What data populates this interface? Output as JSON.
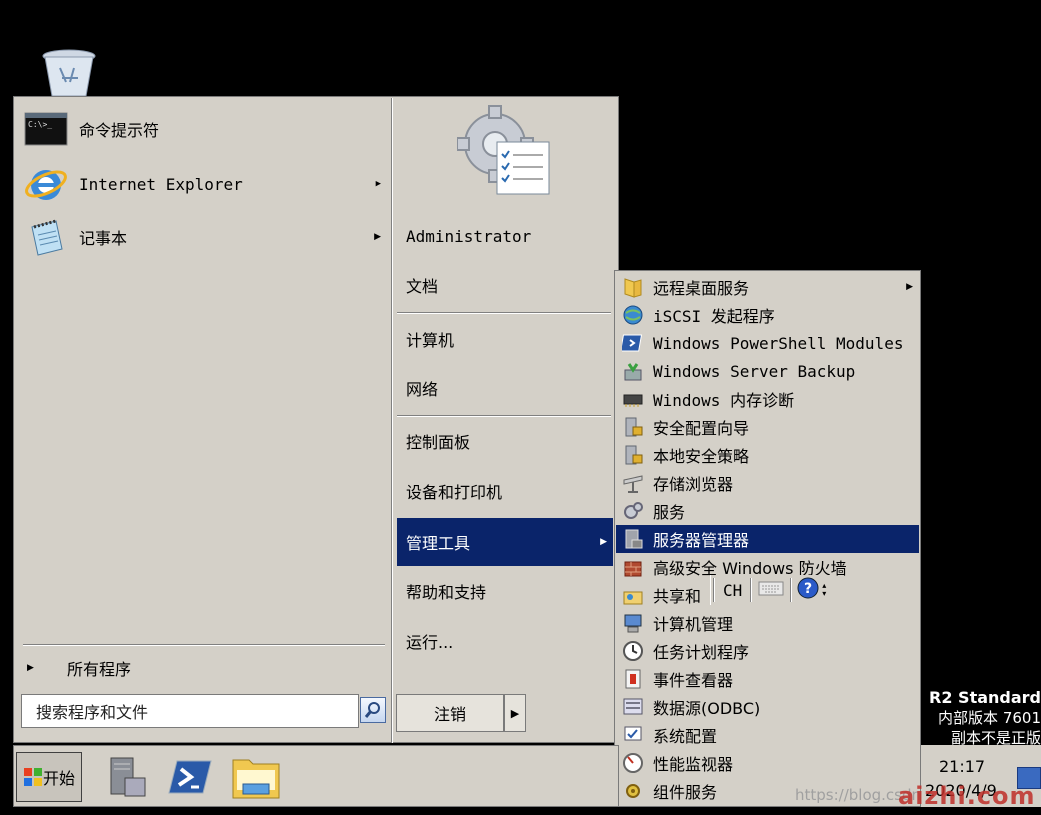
{
  "desktop": {
    "recycle_bin_icon": "recycle-bin-icon"
  },
  "start_menu": {
    "pinned_programs": [
      {
        "label": "命令提示符",
        "icon": "cmd-icon",
        "has_submenu": false
      },
      {
        "label": "Internet Explorer",
        "icon": "ie-icon",
        "has_submenu": true
      },
      {
        "label": "记事本",
        "icon": "notepad-icon",
        "has_submenu": true
      }
    ],
    "all_programs_label": "所有程序",
    "search_placeholder": "搜索程序和文件",
    "right_items": [
      {
        "label": "Administrator"
      },
      {
        "label": "文档"
      },
      {
        "label": "计算机"
      },
      {
        "label": "网络"
      },
      {
        "label": "控制面板"
      },
      {
        "label": "设备和打印机"
      },
      {
        "label": "管理工具",
        "selected": true,
        "has_submenu": true
      },
      {
        "label": "帮助和支持"
      },
      {
        "label": "运行..."
      }
    ],
    "logoff_label": "注销"
  },
  "admin_tools_submenu": {
    "items": [
      {
        "label": "远程桌面服务",
        "icon": "folder-icon",
        "has_submenu": true
      },
      {
        "label": "iSCSI 发起程序",
        "icon": "iscsi-icon"
      },
      {
        "label": "Windows PowerShell Modules",
        "icon": "powershell-icon"
      },
      {
        "label": "Windows Server Backup",
        "icon": "backup-icon"
      },
      {
        "label": "Windows 内存诊断",
        "icon": "memory-icon"
      },
      {
        "label": "安全配置向导",
        "icon": "security-wizard-icon"
      },
      {
        "label": "本地安全策略",
        "icon": "local-policy-icon"
      },
      {
        "label": "存储浏览器",
        "icon": "storage-icon"
      },
      {
        "label": "服务",
        "icon": "services-icon"
      },
      {
        "label": "服务器管理器",
        "icon": "server-manager-icon",
        "selected": true
      },
      {
        "label": "高级安全 Windows 防火墙",
        "icon": "firewall-icon"
      },
      {
        "label": "共享和",
        "icon": "share-icon"
      },
      {
        "label": "计算机管理",
        "icon": "computer-mgmt-icon"
      },
      {
        "label": "任务计划程序",
        "icon": "task-scheduler-icon"
      },
      {
        "label": "事件查看器",
        "icon": "event-viewer-icon"
      },
      {
        "label": "数据源(ODBC)",
        "icon": "odbc-icon"
      },
      {
        "label": "系统配置",
        "icon": "sysconfig-icon"
      },
      {
        "label": "性能监视器",
        "icon": "perfmon-icon"
      },
      {
        "label": "组件服务",
        "icon": "component-services-icon"
      }
    ]
  },
  "language_bar": {
    "lang": "CH"
  },
  "taskbar": {
    "start_label": "开始",
    "pinned": [
      "server-manager-icon",
      "powershell-icon",
      "explorer-icon"
    ],
    "time": "21:17",
    "date": "2020/4/9"
  },
  "watermark": {
    "line1": "R2 Standard",
    "line2": "内部版本 7601",
    "line3": "副本不是正版",
    "blog": "https://blog.csdn",
    "site": "aizhi.com"
  },
  "colors": {
    "menu_bg": "#d4d0c8",
    "selection": "#0a246a",
    "desktop": "#000000"
  }
}
